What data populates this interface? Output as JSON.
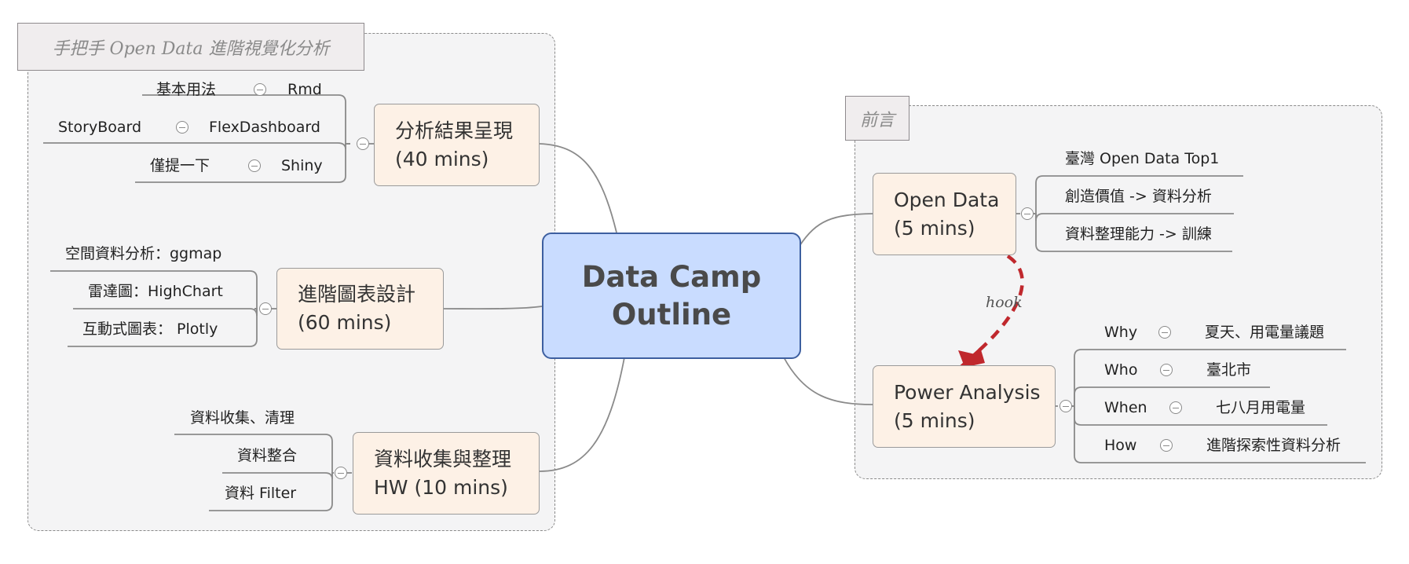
{
  "central": {
    "line1": "Data Camp",
    "line2": "Outline"
  },
  "left_boundary": {
    "title": "手把手 Open Data 進階視覺化分析"
  },
  "right_boundary": {
    "title": "前言"
  },
  "branches": {
    "presentation": {
      "line1": "分析結果呈現",
      "line2": "(40 mins)",
      "children": [
        {
          "label": "基本用法",
          "sub": "Rmd"
        },
        {
          "label": "StoryBoard",
          "sub": "FlexDashboard"
        },
        {
          "label": "僅提一下",
          "sub": "Shiny"
        }
      ]
    },
    "charts": {
      "line1": "進階圖表設計",
      "line2": "(60 mins)",
      "children": [
        "空間資料分析：ggmap",
        "雷達圖：HighChart",
        "互動式圖表： Plotly"
      ]
    },
    "collection": {
      "line1": "資料收集與整理",
      "line2": "HW (10 mins)",
      "children": [
        "資料收集、清理",
        "資料整合",
        "資料 Filter"
      ]
    },
    "open_data": {
      "line1": "Open Data",
      "line2": "(5 mins)",
      "children": [
        "臺灣 Open Data Top1",
        "創造價值 -> 資料分析",
        "資料整理能力 -> 訓練"
      ]
    },
    "power": {
      "line1": "Power Analysis",
      "line2": "(5 mins)",
      "children": [
        {
          "label": "Why",
          "sub": "夏天、用電量議題"
        },
        {
          "label": "Who",
          "sub": "臺北市"
        },
        {
          "label": "When",
          "sub": "七八月用電量"
        },
        {
          "label": "How",
          "sub": "進階探索性資料分析"
        }
      ]
    }
  },
  "relationship": {
    "label": "hook",
    "color": "#c0282d"
  }
}
